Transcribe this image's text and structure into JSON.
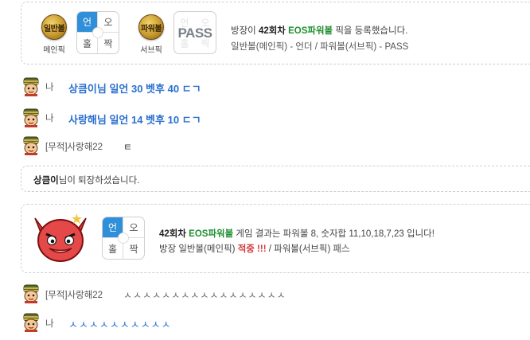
{
  "pick_card": {
    "main_badge": {
      "text": "일반볼",
      "sub": "메인픽"
    },
    "main_grid": {
      "cells": [
        "언",
        "오",
        "홀",
        "짝"
      ],
      "selected": "언"
    },
    "sub_badge": {
      "text": "파워볼",
      "sub": "서브픽"
    },
    "sub_grid": {
      "cells": [
        "언",
        "오",
        "홀",
        "짝"
      ],
      "pass_label": "PASS"
    },
    "line1": {
      "prefix": "방장이 ",
      "round": "42회차",
      "space": " ",
      "game": "EOS파워볼",
      "suffix": " 픽을 등록했습니다."
    },
    "line2": "일반볼(메인픽) - 언더 / 파워볼(서브픽) - PASS"
  },
  "chats": [
    {
      "name": "나",
      "message": "상큼이님 일언 30 벳후 40 ㄷㄱ"
    },
    {
      "name": "나",
      "message": "사랑해님 일언 14 벳후 10 ㄷㄱ"
    },
    {
      "name": "[무적]사랑해22",
      "message": "ㅌ"
    }
  ],
  "leave_notice": {
    "user": "상큼이",
    "text": "님이 퇴장하셨습니다."
  },
  "result_card": {
    "grid": {
      "cells": [
        "언",
        "오",
        "홀",
        "짝"
      ],
      "selected": "언"
    },
    "line1": {
      "round": "42회차",
      "space": " ",
      "game": "EOS파워볼",
      "text": " 게임 결과는 파워볼 8, 숫자합 11,10,18,7,23 입니다!"
    },
    "line2": {
      "prefix": "방장 일반볼(메인픽) ",
      "hit": "적중 !!!",
      "middle": " / 파워볼(서브픽) ",
      "pass": "패스"
    }
  },
  "chats2": [
    {
      "name": "[무적]사랑해22",
      "message": "ㅅㅅㅅㅅㅅㅅㅅㅅㅅㅅㅅㅅㅅㅅㅅㅅㅅ"
    },
    {
      "name": "나",
      "message": "ㅅㅅㅅㅅㅅㅅㅅㅅㅅㅅ"
    }
  ],
  "colors": {
    "accent_blue": "#2f8fd8",
    "chat_blue": "#2a6fcf",
    "green": "#1f8f2f",
    "red": "#d23a3a"
  },
  "icons": {
    "avatar": "soldier-avatar-icon",
    "devil": "devil-emoji-icon"
  }
}
